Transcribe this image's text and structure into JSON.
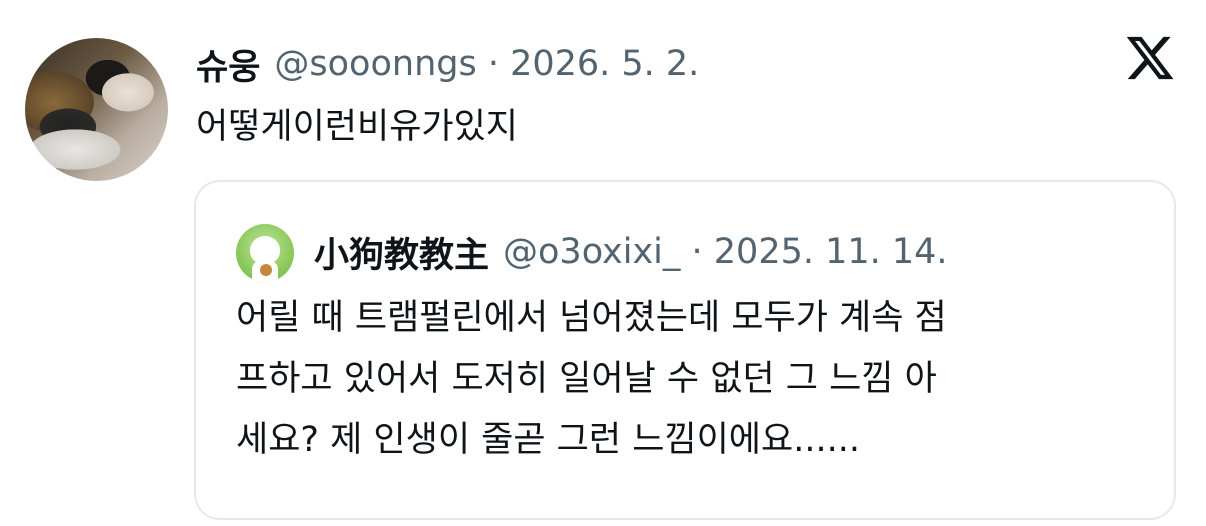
{
  "tweet": {
    "display_name": "슈웅",
    "handle_date": "@sooonngs · 2026. 5. 2.",
    "text": "어떻게이런비유가있지",
    "avatar_icon": "profile-photo"
  },
  "brand": {
    "logo_icon": "x-logo-icon"
  },
  "quote": {
    "display_name": "小狗教教主",
    "handle_date": "@o3oxixi_ · 2025. 11. 14.",
    "avatar_icon": "green-mascot-avatar",
    "lines": [
      "어릴 때 트램펄린에서 넘어졌는데 모두가 계속 점",
      "프하고 있어서 도저히 일어날 수 없던 그 느낌 아",
      "세요? 제 인생이 줄곧 그런 느낌이에요......"
    ]
  },
  "colors": {
    "text_primary": "#0f1419",
    "text_secondary": "#536471",
    "border": "#e6e9ec"
  }
}
